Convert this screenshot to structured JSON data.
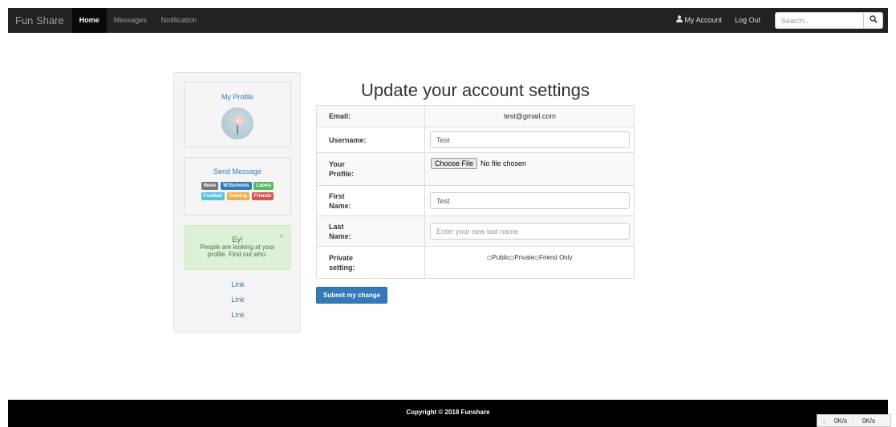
{
  "navbar": {
    "brand": "Fun Share",
    "items": [
      "Home",
      "Messages",
      "Notification"
    ],
    "my_account": "My Account",
    "logout": "Log Out",
    "search_placeholder": "Search.."
  },
  "sidebar": {
    "profile_title": "My Profile",
    "send_message": "Send Message",
    "labels": [
      {
        "text": "News",
        "color": "#777777"
      },
      {
        "text": "W3Schools",
        "color": "#337ab7"
      },
      {
        "text": "Labels",
        "color": "#5cb85c"
      },
      {
        "text": "Football",
        "color": "#5bc0de"
      },
      {
        "text": "Gaming",
        "color": "#f0ad4e"
      },
      {
        "text": "Friends",
        "color": "#d9534f"
      }
    ],
    "alert_title": "Ey!",
    "alert_close": "×",
    "alert_text": "People are looking at your profile. Find out who.",
    "links": [
      "Link",
      "Link",
      "Link"
    ]
  },
  "main": {
    "title": "Update your account settings",
    "rows": {
      "email": {
        "label": "Email:",
        "value": "test@gmail.com"
      },
      "username": {
        "label": "Username:",
        "value": "Test"
      },
      "profile": {
        "label": "Your Profile:",
        "button": "Choose File",
        "status": "No file chosen"
      },
      "first": {
        "label": "First Name:",
        "value": "Test"
      },
      "last": {
        "label": "Last Name:",
        "placeholder": "Enter your new last name"
      },
      "private": {
        "label": "Private setting:",
        "options": [
          "Public",
          "Private",
          "Friend Only"
        ]
      }
    },
    "submit": "Submit my change"
  },
  "footer": {
    "copyright": "Copyright © 2018 Funshare"
  },
  "speed_widget": {
    "down": "0K/s",
    "up": "0K/s"
  },
  "colors": {
    "primary": "#337ab7",
    "navbar": "#222222",
    "footer": "#000000",
    "alert_bg": "#dff0d8"
  }
}
